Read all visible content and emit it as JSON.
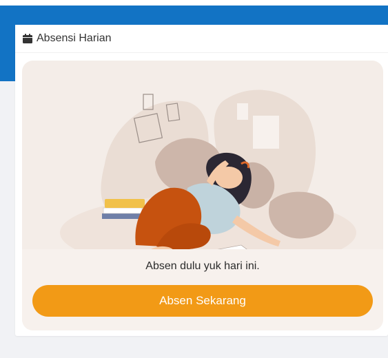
{
  "card": {
    "title": "Absensi Harian",
    "title_icon": "calendar-icon"
  },
  "panel": {
    "illustration": "woman-lying-on-floor-illustration",
    "message": "Absen dulu yuk hari ini.",
    "button_label": "Absen Sekarang"
  },
  "colors": {
    "header_blue": "#1273c4",
    "button_orange": "#f29a16",
    "panel_bg": "#f4ede8"
  }
}
